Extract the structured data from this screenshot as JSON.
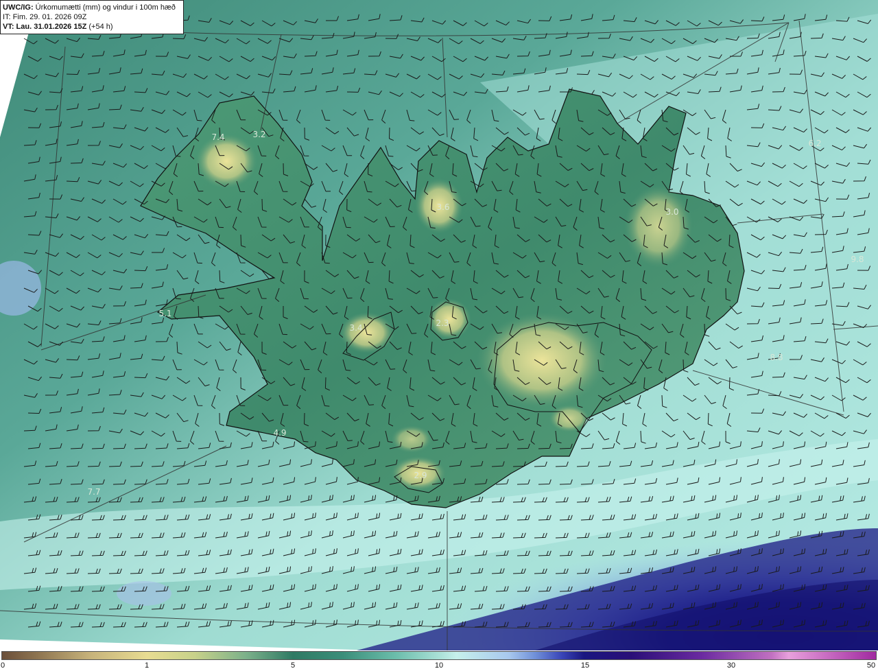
{
  "header": {
    "product": "UWC/IG:",
    "description": "Úrkomumætti (mm) og vindur i 100m hæð",
    "init_time": "IT: Fim. 29. 01. 2026 09Z",
    "valid_time_label": "VT: Lau. 31.01.2026 15Z",
    "valid_time_offset": "(+54 h)"
  },
  "map_values": [
    {
      "value": "7.4"
    },
    {
      "value": "3.2"
    },
    {
      "value": "3.6"
    },
    {
      "value": "3.0"
    },
    {
      "value": "6.2"
    },
    {
      "value": "9.8"
    },
    {
      "value": "5.1"
    },
    {
      "value": "3.4"
    },
    {
      "value": "2.3"
    },
    {
      "value": "4.9"
    },
    {
      "value": "2.9"
    },
    {
      "value": "7.7"
    },
    {
      "value": "8.8"
    }
  ],
  "colorbar": {
    "ticks": [
      "0",
      "1",
      "5",
      "10",
      "15",
      "30",
      "50"
    ]
  },
  "colors": {
    "land_low": "#3d8a6e",
    "land_high": "#e2dc8c",
    "sea": "#8fd8cc",
    "sea_high_precip": "#1a1680",
    "coastline": "#111111"
  }
}
